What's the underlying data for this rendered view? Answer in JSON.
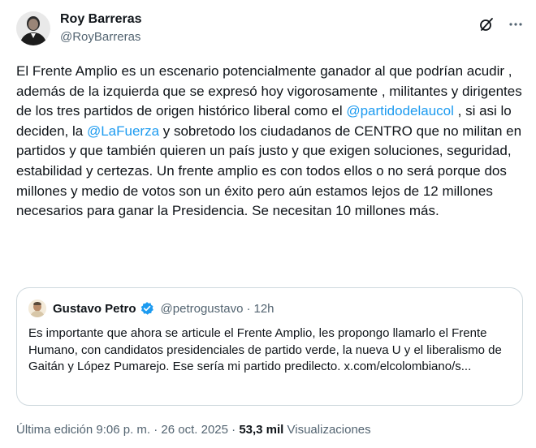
{
  "author": {
    "display_name": "Roy Barreras",
    "handle": "@RoyBarreras"
  },
  "icons": {
    "grok": "grok-icon",
    "more": "more-icon",
    "verified": "verified-badge-icon"
  },
  "tweet": {
    "text_before_mention_1": "El Frente Amplio es un escenario potencialmente ganador al que podrían acudir , además de la izquierda que se expresó hoy vigorosamente , militantes y dirigentes de los tres partidos de origen histórico liberal como el ",
    "mention_1": "@partidodelaucol",
    "text_between_mentions": " , si asi lo deciden, la ",
    "mention_2": "@LaFuerza",
    "text_after_mention_2": " y sobretodo los ciudadanos de CENTRO que no militan en partidos y que también quieren un país justo y que exigen soluciones, seguridad, estabilidad y certezas. Un frente amplio es con todos ellos o no será porque dos millones y medio de votos son un éxito pero aún estamos lejos de 12 millones necesarios para ganar la Presidencia. Se necesitan 10 millones más."
  },
  "quoted_tweet": {
    "display_name": "Gustavo Petro",
    "handle": "@petrogustavo",
    "separator": "·",
    "time": "12h",
    "text": "Es importante que ahora se articule el Frente Amplio, les propongo llamarlo el Frente Humano, con candidatos presidenciales de partido verde, la nueva U y el liberalismo de Gaitán y López Pumarejo. Ese sería mi partido predilecto. x.com/elcolombiano/s..."
  },
  "meta": {
    "edited_label": "Última edición 9:06 p. m. · 26 oct. 2025 · ",
    "views_count": "53,3 mil",
    "views_label": " Visualizaciones"
  },
  "colors": {
    "link": "#1d9bf0",
    "secondary_text": "#536471",
    "primary_text": "#0f1419",
    "border": "#cfd9de",
    "verified": "#1d9bf0"
  }
}
